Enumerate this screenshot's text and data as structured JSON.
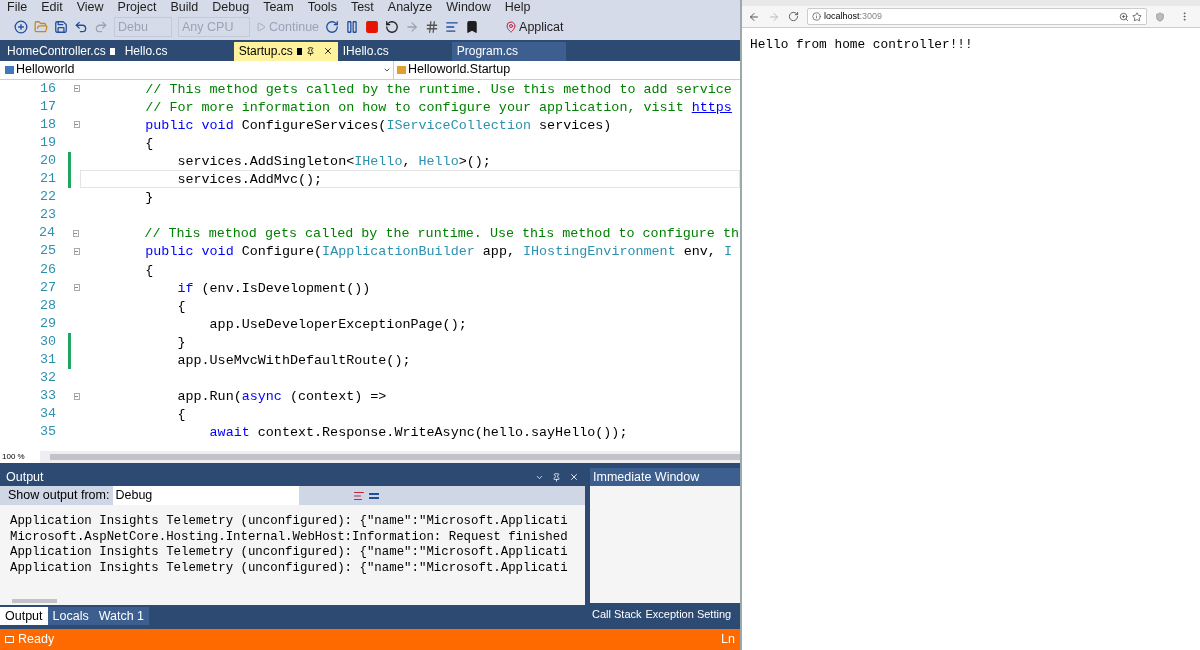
{
  "menu": [
    "File",
    "Edit",
    "View",
    "Project",
    "Build",
    "Debug",
    "Team",
    "Tools",
    "Test",
    "Analyze",
    "Window",
    "Help"
  ],
  "toolbar": {
    "configuration": "Debu",
    "platform": "Any CPU",
    "continue": "Continue",
    "target": "Applicat"
  },
  "tabs": [
    {
      "label": "HomeController.cs",
      "selected": false,
      "pinned": true
    },
    {
      "label": "Hello.cs",
      "selected": false,
      "pinned": false
    },
    {
      "label": "Startup.cs",
      "selected": true,
      "pinned": true
    },
    {
      "label": "IHello.cs",
      "selected": false,
      "pinned": false
    },
    {
      "label": "Program.cs",
      "selected": false,
      "pinned": false
    }
  ],
  "nav": {
    "project": "Helloworld",
    "class": "Helloworld.Startup"
  },
  "code": [
    {
      "n": "16",
      "fold": true,
      "changed": false,
      "current": false,
      "segs": [
        {
          "kind": "comment",
          "text": "        // This method gets called by the runtime. Use this method to add service"
        }
      ]
    },
    {
      "n": "17",
      "fold": false,
      "changed": false,
      "current": false,
      "segs": [
        {
          "kind": "comment",
          "text": "        // For more information on how to configure your application, visit "
        },
        {
          "kind": "link",
          "text": "https"
        }
      ]
    },
    {
      "n": "18",
      "fold": true,
      "changed": false,
      "current": false,
      "segs": [
        {
          "kind": "keyword",
          "text": "        public void"
        },
        {
          "kind": "plain",
          "text": " ConfigureServices("
        },
        {
          "kind": "type",
          "text": "IServiceCollection"
        },
        {
          "kind": "plain",
          "text": " services)"
        }
      ]
    },
    {
      "n": "19",
      "fold": false,
      "changed": false,
      "current": false,
      "segs": [
        {
          "kind": "plain",
          "text": "        {"
        }
      ]
    },
    {
      "n": "20",
      "fold": false,
      "changed": true,
      "current": false,
      "segs": [
        {
          "kind": "plain",
          "text": "            services.AddSingleton<"
        },
        {
          "kind": "type",
          "text": "IHello"
        },
        {
          "kind": "plain",
          "text": ", "
        },
        {
          "kind": "type",
          "text": "Hello"
        },
        {
          "kind": "plain",
          "text": ">();"
        }
      ]
    },
    {
      "n": "21",
      "fold": false,
      "changed": true,
      "current": true,
      "segs": [
        {
          "kind": "plain",
          "text": "            services.AddMvc();"
        }
      ]
    },
    {
      "n": "22",
      "fold": false,
      "changed": false,
      "current": false,
      "segs": [
        {
          "kind": "plain",
          "text": "        }"
        }
      ]
    },
    {
      "n": "23",
      "fold": false,
      "changed": false,
      "current": false
    },
    {
      "n": "24",
      "fold": true,
      "changed": false,
      "current": false,
      "segs": [
        {
          "kind": "comment",
          "text": "        // This method gets called by the runtime. Use this method to configure th"
        }
      ]
    },
    {
      "n": "25",
      "fold": true,
      "changed": false,
      "current": false,
      "segs": [
        {
          "kind": "keyword",
          "text": "        public void"
        },
        {
          "kind": "plain",
          "text": " Configure("
        },
        {
          "kind": "type",
          "text": "IApplicationBuilder"
        },
        {
          "kind": "plain",
          "text": " app, "
        },
        {
          "kind": "type",
          "text": "IHostingEnvironment"
        },
        {
          "kind": "plain",
          "text": " env, "
        },
        {
          "kind": "type",
          "text": "I"
        }
      ]
    },
    {
      "n": "26",
      "fold": false,
      "changed": false,
      "current": false,
      "segs": [
        {
          "kind": "plain",
          "text": "        {"
        }
      ]
    },
    {
      "n": "27",
      "fold": true,
      "changed": false,
      "current": false,
      "segs": [
        {
          "kind": "keyword",
          "text": "            if"
        },
        {
          "kind": "plain",
          "text": " (env.IsDevelopment())"
        }
      ]
    },
    {
      "n": "28",
      "fold": false,
      "changed": false,
      "current": false,
      "segs": [
        {
          "kind": "plain",
          "text": "            {"
        }
      ]
    },
    {
      "n": "29",
      "fold": false,
      "changed": false,
      "current": false,
      "segs": [
        {
          "kind": "plain",
          "text": "                app.UseDeveloperExceptionPage();"
        }
      ]
    },
    {
      "n": "30",
      "fold": false,
      "changed": true,
      "current": false,
      "segs": [
        {
          "kind": "plain",
          "text": "            }"
        }
      ]
    },
    {
      "n": "31",
      "fold": false,
      "changed": true,
      "current": false,
      "segs": [
        {
          "kind": "plain",
          "text": "            app.UseMvcWithDefaultRoute();"
        }
      ]
    },
    {
      "n": "32",
      "fold": false,
      "changed": false,
      "current": false
    },
    {
      "n": "33",
      "fold": true,
      "changed": false,
      "current": false,
      "segs": [
        {
          "kind": "plain",
          "text": "            app.Run("
        },
        {
          "kind": "keyword",
          "text": "async"
        },
        {
          "kind": "plain",
          "text": " (context) =>"
        }
      ]
    },
    {
      "n": "34",
      "fold": false,
      "changed": false,
      "current": false,
      "segs": [
        {
          "kind": "plain",
          "text": "            {"
        }
      ]
    },
    {
      "n": "35",
      "fold": false,
      "changed": false,
      "current": false,
      "segs": [
        {
          "kind": "keyword",
          "text": "                await"
        },
        {
          "kind": "plain",
          "text": " context.Response.WriteAsync(hello.sayHello());"
        }
      ]
    }
  ],
  "zoom": "100 %",
  "output": {
    "title": "Output",
    "source_label": "Show output from:",
    "source": "Debug",
    "lines": [
      "Application Insights Telemetry (unconfigured): {\"name\":\"Microsoft.Applicati",
      "Microsoft.AspNetCore.Hosting.Internal.WebHost:Information: Request finished",
      "Application Insights Telemetry (unconfigured): {\"name\":\"Microsoft.Applicati",
      "Application Insights Telemetry (unconfigured): {\"name\":\"Microsoft.Applicati"
    ]
  },
  "immediate": {
    "title": "Immediate Window"
  },
  "bottom_tabs": [
    {
      "label": "Output",
      "selected": true
    },
    {
      "label": "Locals",
      "selected": false
    },
    {
      "label": "Watch 1",
      "selected": false
    }
  ],
  "right_tabs": [
    {
      "label": "Call Stack",
      "selected": false
    },
    {
      "label": "Exception Setting",
      "selected": false
    }
  ],
  "status": {
    "text": "Ready",
    "position": "Ln"
  },
  "browser": {
    "host": "localhost",
    "port": ":3009",
    "body": "Hello from home controller!!!"
  }
}
